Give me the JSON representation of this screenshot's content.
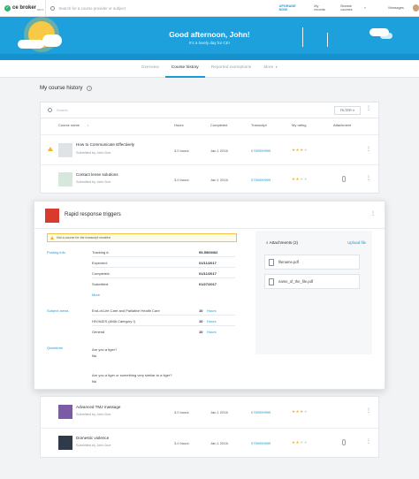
{
  "topbar": {
    "logo_text": "ce broker",
    "logo_beta": "BETA",
    "search_placeholder": "Search for a course provider or subject",
    "upgrade": "UPGRADE NOW",
    "my_records": "My records",
    "browse_courses": "Browse courses",
    "messages": "Messages"
  },
  "hero": {
    "title": "Good afternoon, John!",
    "subtitle": "It's a lovely day for CE!"
  },
  "tabs": [
    "Overview",
    "Course history",
    "Reported exemptions",
    "More"
  ],
  "section_title": "My course history",
  "table": {
    "search_placeholder": "Search",
    "filter_label": "FILTER",
    "headers": [
      "Course name",
      "Hours",
      "Completed",
      "Transcript",
      "My rating",
      "Attachment"
    ],
    "rows": [
      {
        "name": "How to Communicate Effectively",
        "sub": "Submitted by John Doe",
        "hours": "3.0 hours",
        "completed": "Jan 1 2016",
        "transcript": "0759999999",
        "rating": 3
      },
      {
        "name": "Contact lense solutions",
        "sub": "Submitted by John Doe",
        "hours": "3.0 hours",
        "completed": "Jan 1 2016",
        "transcript": "0759999999",
        "rating": 2
      }
    ],
    "rows2": [
      {
        "name": "Advanced TMJ massage",
        "sub": "Submitted by John Doe",
        "hours": "3.0 hours",
        "completed": "Jan 1 2016",
        "transcript": "0759999999",
        "rating": 3
      },
      {
        "name": "Domestic violence",
        "sub": "Submitted by John Doe",
        "hours": "3.0 hours",
        "completed": "Jan 1 2016",
        "transcript": "0759999999",
        "rating": 2
      }
    ]
  },
  "detail": {
    "title": "Rapid response triggers",
    "alert": "Not a course for the transcript recalled",
    "posting_info_label": "Posting info",
    "fields": [
      {
        "key": "Tracking #:",
        "value": "99-5569402"
      },
      {
        "key": "Expected:",
        "value": "01/11/2017"
      },
      {
        "key": "Completed:",
        "value": "01/11/2017"
      },
      {
        "key": "Submitted:",
        "value": "01/27/2017"
      }
    ],
    "more": "More",
    "subject_label": "Subject areas",
    "subjects": [
      {
        "name": "End-of-Life Care and Palliative Health Care",
        "hours": "10",
        "unit": "Hours"
      },
      {
        "name": "HIV/AIDS (AMA Category I)",
        "hours": "10",
        "unit": "Hours"
      },
      {
        "name": "General",
        "hours": "10",
        "unit": "Hours"
      }
    ],
    "questions_label": "Questions",
    "questions": [
      {
        "q": "Are you a tiger?",
        "a": "No"
      },
      {
        "q": "Are you a tiger or something very similar to a tiger?",
        "a": "No"
      }
    ],
    "attachments_title": "Attachments (2)",
    "upload": "Upload file",
    "files": [
      "filename.pdf",
      "name_of_the_file.pdf"
    ]
  },
  "colors": {
    "accent": "#1a9ad6",
    "hero": "#1ea0dc",
    "star": "#f3b32a",
    "brand_green": "#33b36b"
  }
}
